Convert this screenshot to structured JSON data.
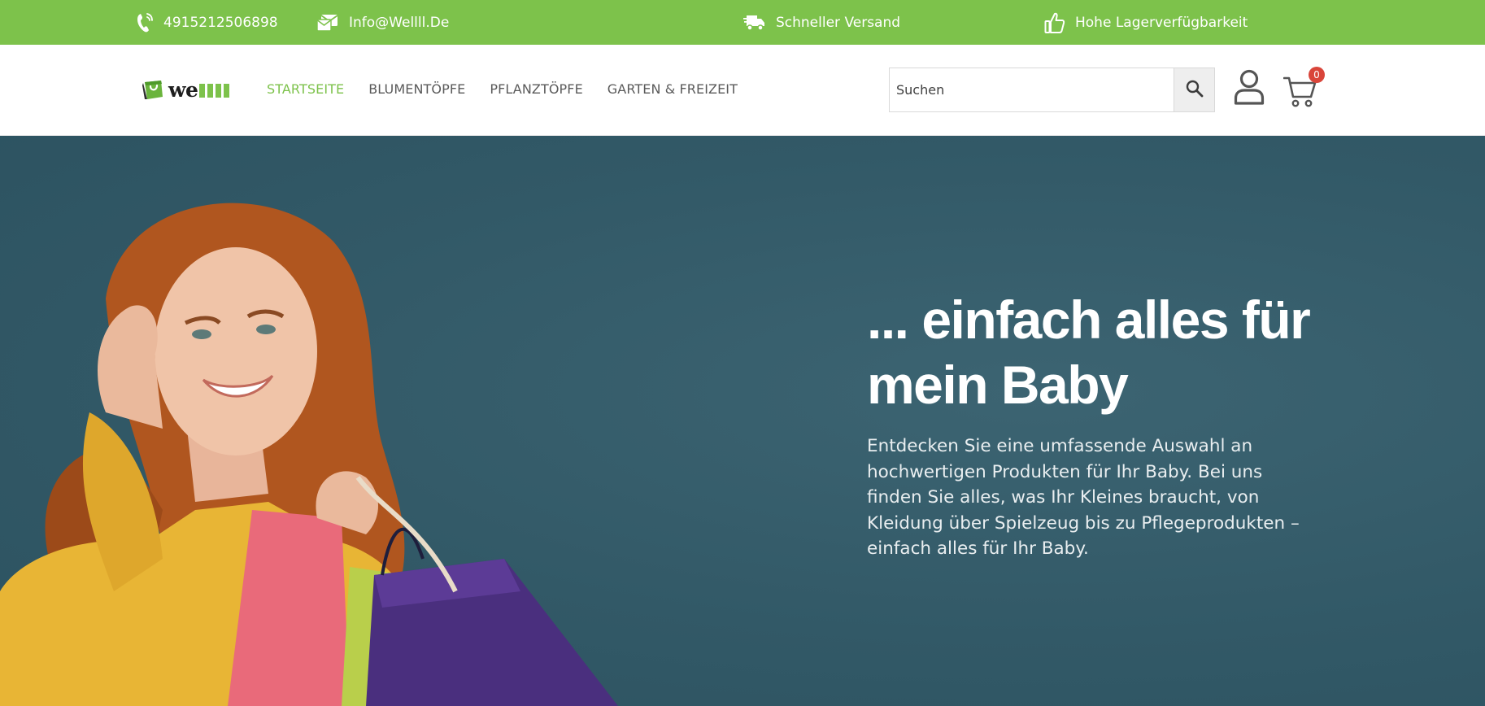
{
  "topbar": {
    "background": "#7dc24b",
    "phone": {
      "icon": "phone-icon",
      "text": "4915212506898"
    },
    "email": {
      "icon": "mail-icon",
      "text": "Info@Wellll.De"
    },
    "shipping": {
      "icon": "truck-icon",
      "text": "Schneller Versand"
    },
    "stock": {
      "icon": "thumbs-up-icon",
      "text": "Hohe Lagerverfügbarkeit"
    }
  },
  "header": {
    "logo": {
      "word": "we",
      "icon": "shopping-bag-logo-icon"
    },
    "nav": [
      {
        "label": "STARTSEITE",
        "active": true
      },
      {
        "label": "BLUMENTÖPFE",
        "active": false
      },
      {
        "label": "PFLANZTÖPFE",
        "active": false
      },
      {
        "label": "GARTEN & FREIZEIT",
        "active": false
      }
    ],
    "search": {
      "placeholder": "Suchen",
      "button_icon": "search-icon"
    },
    "account_icon": "user-icon",
    "cart": {
      "icon": "cart-icon",
      "count": "0"
    }
  },
  "hero": {
    "title": "... einfach alles für mein Baby",
    "text": "Entdecken Sie eine umfassende Auswahl an hochwertigen Produkten für Ihr Baby. Bei uns finden Sie alles, was Ihr Kleines braucht, von Kleidung über Spielzeug bis zu Pflegeprodukten – einfach alles für Ihr Baby.",
    "accent": "#7dc24b",
    "background": "#325967"
  }
}
